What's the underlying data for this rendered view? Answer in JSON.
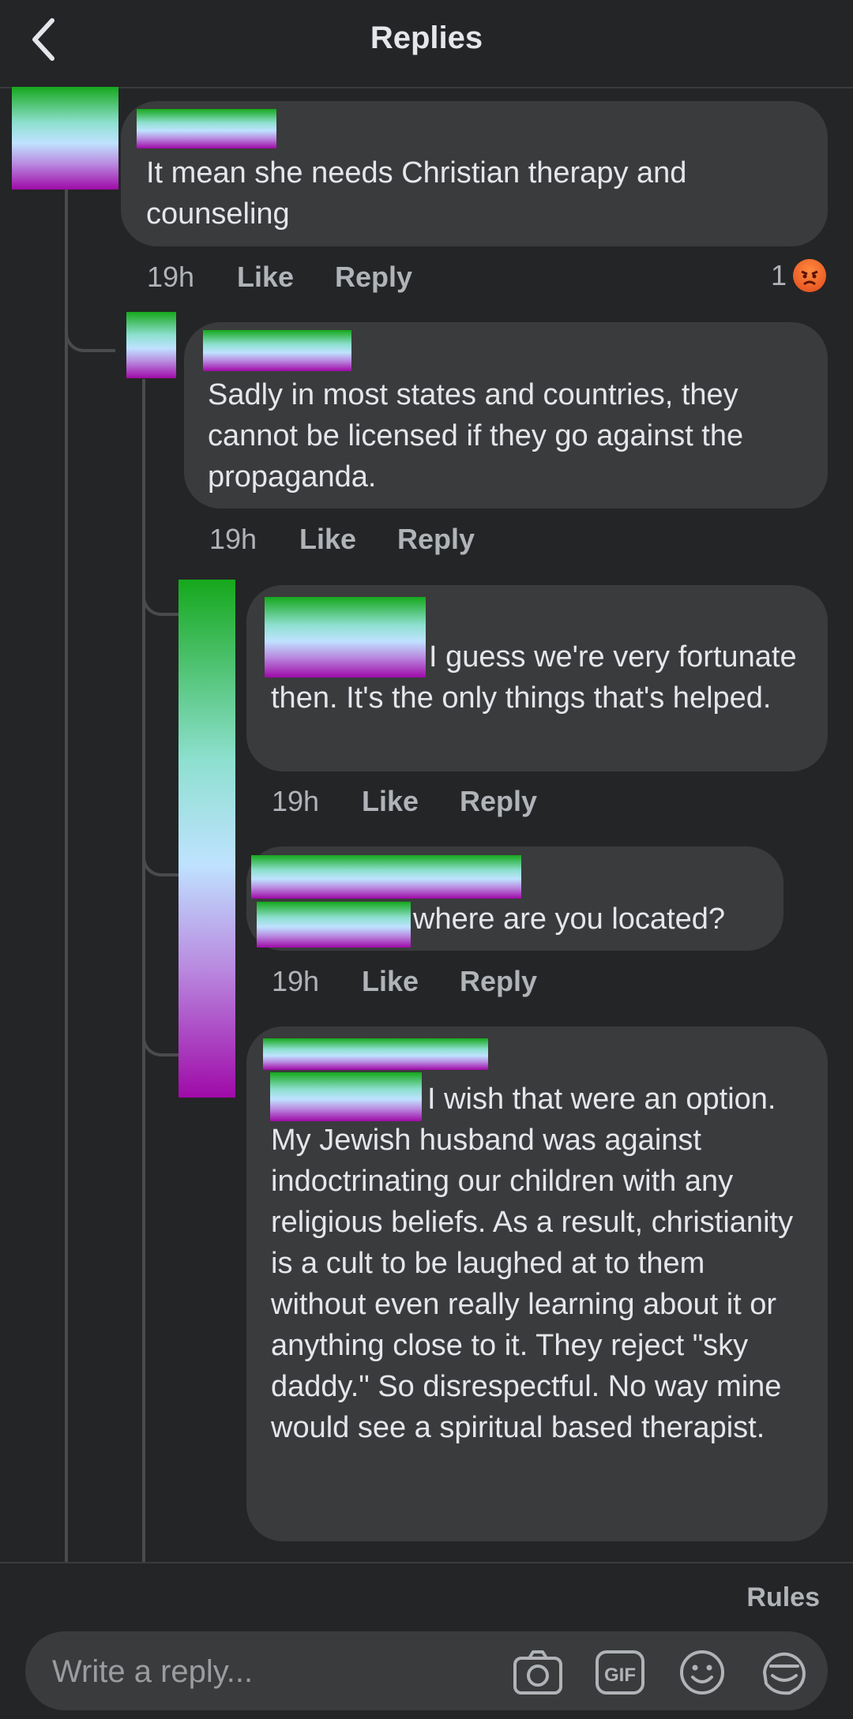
{
  "header": {
    "title": "Replies"
  },
  "comments": [
    {
      "text": "It mean she needs Christian therapy and counseling",
      "time": "19h",
      "like": "Like",
      "reply": "Reply",
      "reaction_count": "1",
      "reaction_icon": "angry-face-icon"
    },
    {
      "text": "Sadly in most states and countries, they cannot be licensed if they go against the propaganda.",
      "time": "19h",
      "like": "Like",
      "reply": "Reply"
    },
    {
      "text": "I guess we're very fortunate then. It's the only things that's helped.",
      "time": "19h",
      "like": "Like",
      "reply": "Reply"
    },
    {
      "text": "where are you located?",
      "time": "19h",
      "like": "Like",
      "reply": "Reply"
    },
    {
      "text": "I wish that were an option.  My Jewish husband was against indoctrinating our children with any religious beliefs.  As a result, christianity is a cult to be laughed at to them without even really learning about it or anything close to it.  They reject \"sky daddy.\"  So disrespectful.  No way mine would see a spiritual based therapist."
    }
  ],
  "footer": {
    "rules": "Rules",
    "input_placeholder": "Write a reply...",
    "icons": [
      "camera-icon",
      "gif-icon",
      "emoji-icon",
      "sticker-icon"
    ],
    "gif_label": "GIF"
  },
  "colors": {
    "background": "#242526",
    "bubble": "#3a3b3c",
    "text": "#e4e6eb",
    "muted": "#b0b3b8",
    "angry_reaction": "#e2481c"
  }
}
